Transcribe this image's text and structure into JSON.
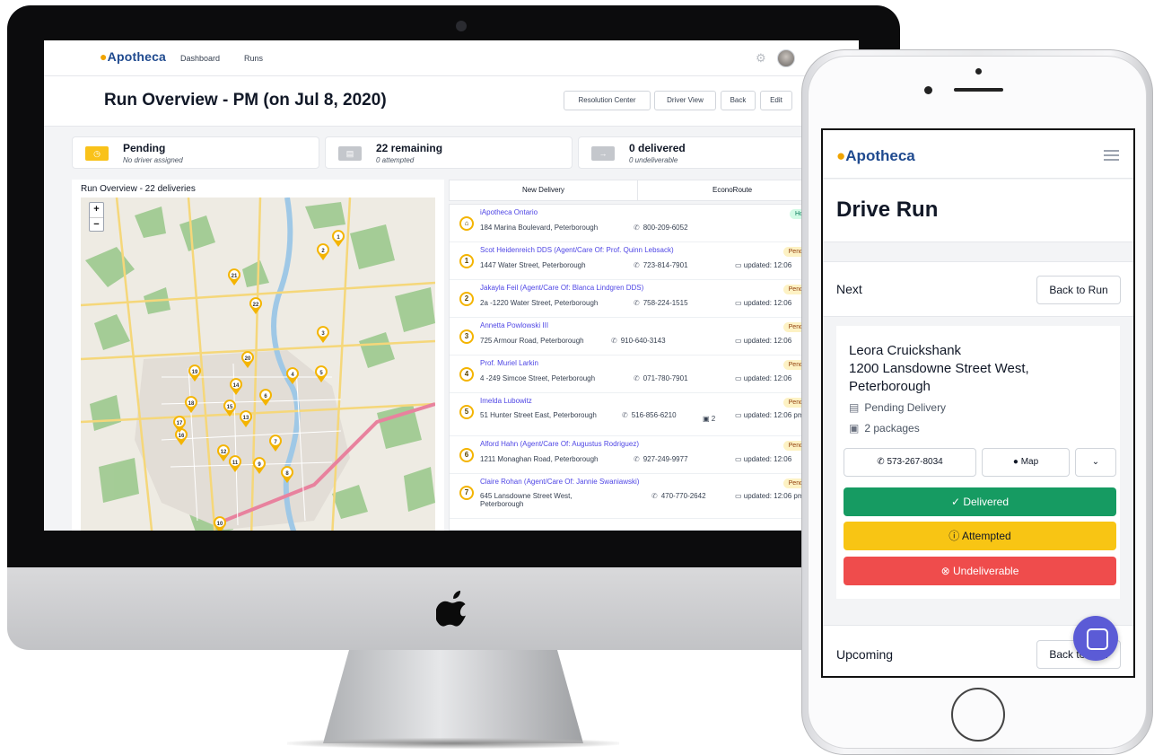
{
  "desktop": {
    "brand": "Apotheca",
    "nav": [
      "Dashboard",
      "Runs"
    ],
    "page_title": "Run Overview - PM (on Jul 8, 2020)",
    "header_buttons": [
      "Resolution Center",
      "Driver View",
      "Back",
      "Edit"
    ],
    "stats": [
      {
        "title": "Pending",
        "subtitle": "No driver assigned",
        "color": "#f9c21a"
      },
      {
        "title": "22 remaining",
        "subtitle": "0 attempted",
        "color": "#c4c7cc"
      },
      {
        "title": "0 delivered",
        "subtitle": "0 undeliverable",
        "color": "#c4c7cc"
      }
    ],
    "map_title": "Run Overview - 22 deliveries",
    "zoom_in": "+",
    "zoom_out": "−",
    "tabs": [
      "New Delivery",
      "EconoRoute"
    ],
    "deliveries": [
      {
        "num": "",
        "name": "iApotheca Ontario",
        "address": "184 Marina Boulevard, Peterborough",
        "phone": "800-209-6052",
        "updated": "",
        "badge": "Ho"
      },
      {
        "num": "1",
        "name": "Scot Heidenreich DDS (Agent/Care Of: Prof. Quinn Lebsack)",
        "address": "1447 Water Street, Peterborough",
        "phone": "723-814-7901",
        "updated": "updated: 12:06",
        "badge": "Pend"
      },
      {
        "num": "2",
        "name": "Jakayla Feil (Agent/Care Of: Blanca Lindgren DDS)",
        "address": "2a -1220 Water Street, Peterborough",
        "phone": "758-224-1515",
        "updated": "updated: 12:06",
        "badge": "Pend"
      },
      {
        "num": "3",
        "name": "Annetta Powlowski III",
        "address": "725 Armour Road, Peterborough",
        "phone": "910-640-3143",
        "updated": "updated: 12:06",
        "badge": "Pend"
      },
      {
        "num": "4",
        "name": "Prof. Muriel Larkin",
        "address": "4 -249 Simcoe Street, Peterborough",
        "phone": "071-780-7901",
        "updated": "updated: 12:06",
        "badge": "Pend"
      },
      {
        "num": "5",
        "name": "Imelda Lubowitz",
        "address": "51 Hunter Street East, Peterborough",
        "phone": "516-856-6210",
        "updated": "updated: 12:06 pm",
        "badge": "Pend",
        "packages": "2"
      },
      {
        "num": "6",
        "name": "Alford Hahn (Agent/Care Of: Augustus Rodriguez)",
        "address": "1211 Monaghan Road, Peterborough",
        "phone": "927-249-9977",
        "updated": "updated: 12:06",
        "badge": "Pend"
      },
      {
        "num": "7",
        "name": "Claire Rohan (Agent/Care Of: Jannie Swaniawski)",
        "address": "645 Lansdowne Street West, Peterborough",
        "phone": "470-770-2642",
        "updated": "updated: 12:06 pm",
        "badge": "Pend"
      }
    ],
    "map_markers": [
      "1",
      "2",
      "3",
      "4",
      "5",
      "6",
      "7",
      "8",
      "9",
      "10",
      "11",
      "12",
      "13",
      "14",
      "15",
      "16",
      "17",
      "18",
      "19",
      "20",
      "21",
      "22"
    ]
  },
  "mobile": {
    "brand": "Apotheca",
    "title": "Drive Run",
    "next_label": "Next",
    "back_to_run": "Back to Run",
    "recipient": "Leora Cruickshank",
    "address": "1200 Lansdowne Street West, Peterborough",
    "status": "Pending Delivery",
    "packages": "2 packages",
    "phone": "573-267-8034",
    "map_label": "Map",
    "delivered": "Delivered",
    "attempted": "Attempted",
    "undeliverable": "Undeliverable",
    "upcoming_label": "Upcoming",
    "upcoming_button": "Back to Run",
    "colors": {
      "delivered": "#169b62",
      "attempted": "#f8c514",
      "undeliverable": "#ef4c4c"
    }
  }
}
